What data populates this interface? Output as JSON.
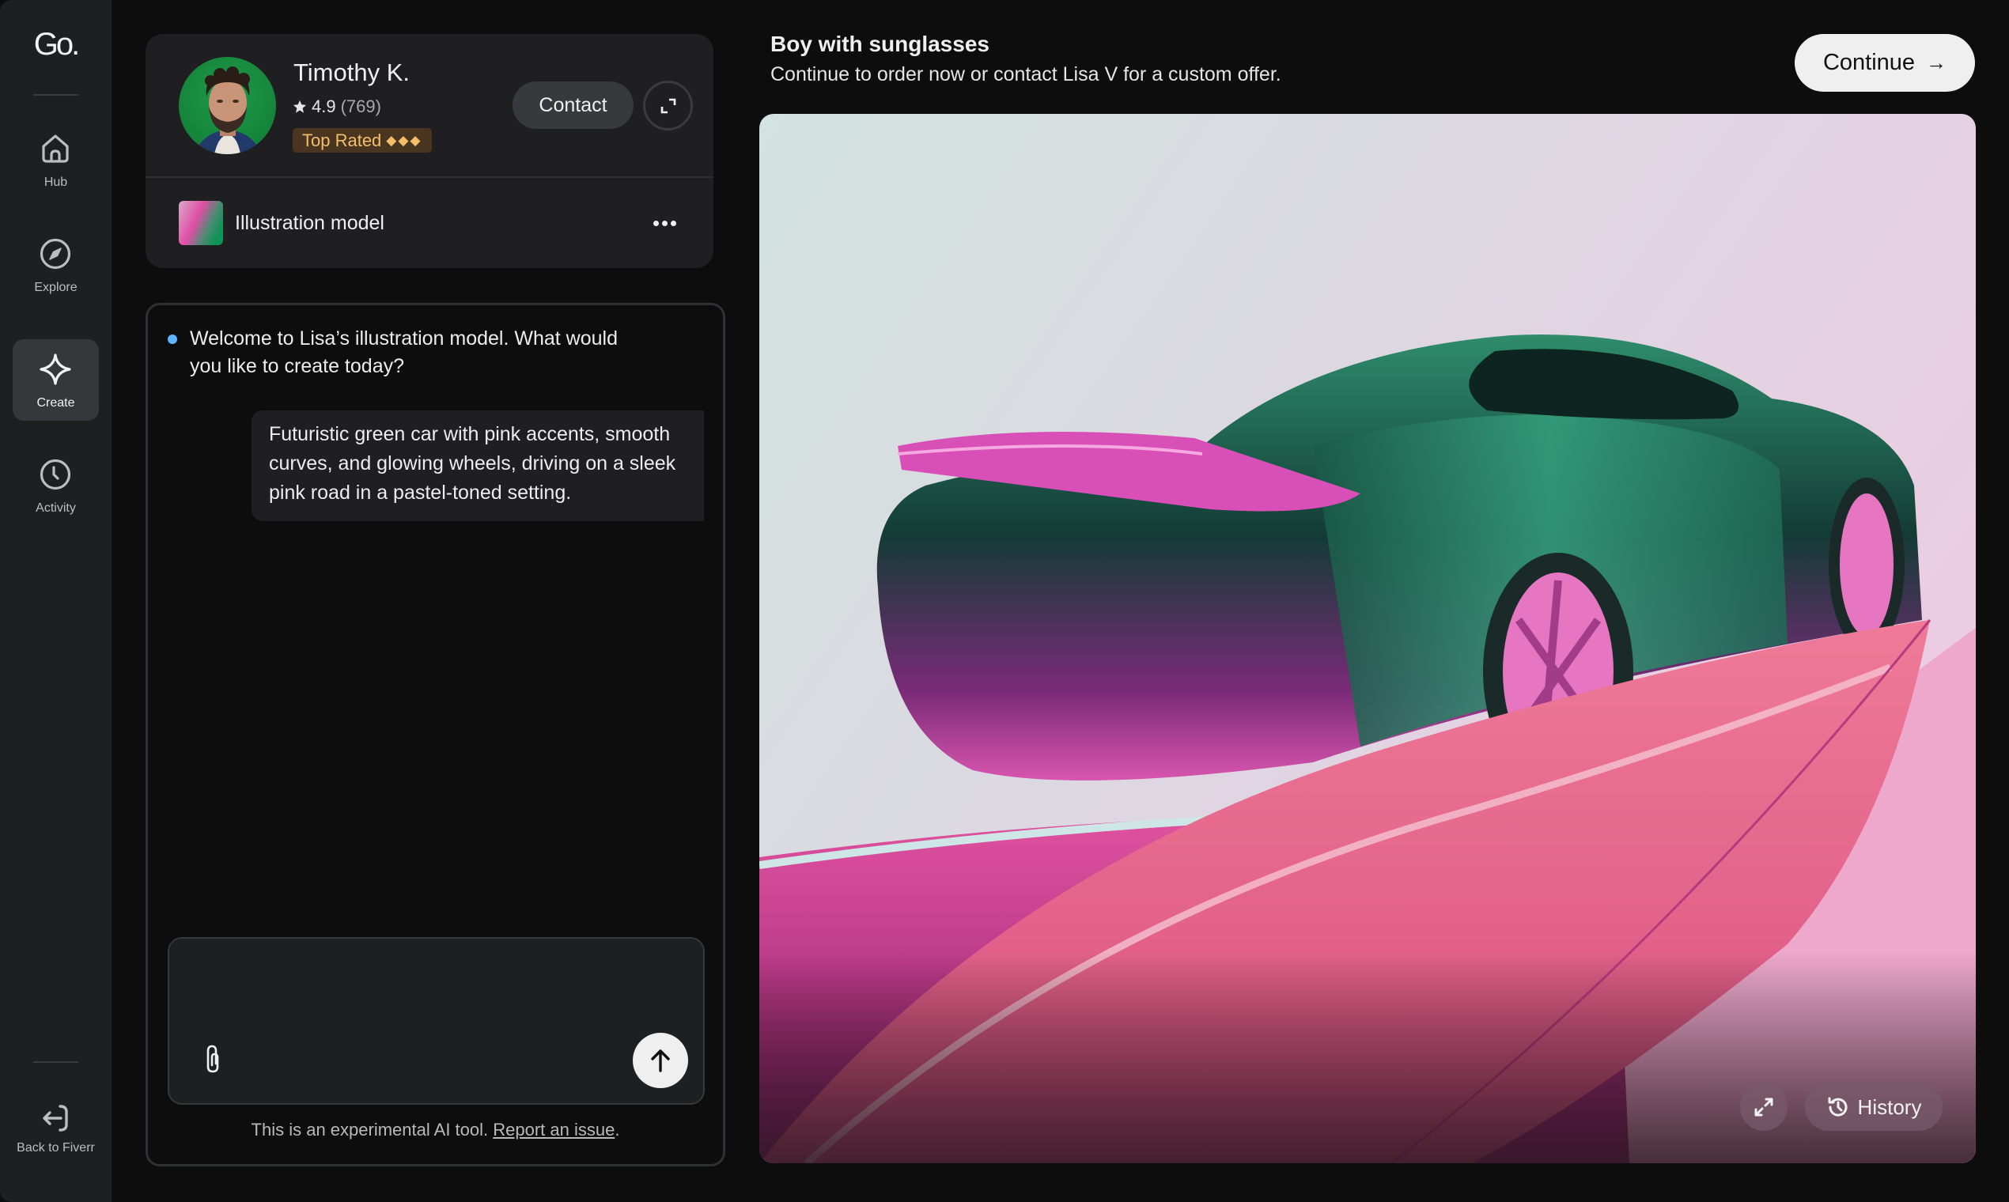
{
  "sidebar": {
    "logo": "Go.",
    "items": [
      {
        "label": "Hub",
        "icon": "home-icon",
        "active": false
      },
      {
        "label": "Explore",
        "icon": "compass-icon",
        "active": false
      },
      {
        "label": "Create",
        "icon": "sparkle-icon",
        "active": true
      },
      {
        "label": "Activity",
        "icon": "clock-icon",
        "active": false
      }
    ],
    "back_label": "Back to Fiverr"
  },
  "profile": {
    "name": "Timothy K.",
    "rating": "4.9",
    "review_count": "(769)",
    "badge": "Top Rated",
    "badge_diamonds": "◆◆◆",
    "contact_label": "Contact",
    "model_name": "Illustration model"
  },
  "chat": {
    "bot_message": "Welcome to Lisa’s illustration model. What would you like to create today?",
    "user_message": "Futuristic green car with pink accents, smooth curves, and glowing wheels, driving on a sleek pink road in a pastel-toned setting.",
    "input_value": "",
    "input_placeholder": "",
    "footer_text": "This is an experimental AI tool.",
    "footer_link": "Report an issue",
    "footer_suffix": "."
  },
  "header": {
    "title": "Boy with sunglasses",
    "subtitle": "Continue to order now or contact Lisa V for a custom offer.",
    "continue_label": "Continue",
    "continue_arrow": "→"
  },
  "image": {
    "description": "Futuristic green car with pink accents on a pink road, pastel background",
    "history_label": "History"
  },
  "colors": {
    "accent_dot": "#5db4ff",
    "badge_bg": "#4a3520",
    "badge_text": "#f4bf6c",
    "car_green": "#1f6e55",
    "road_pink": "#e8668c"
  }
}
